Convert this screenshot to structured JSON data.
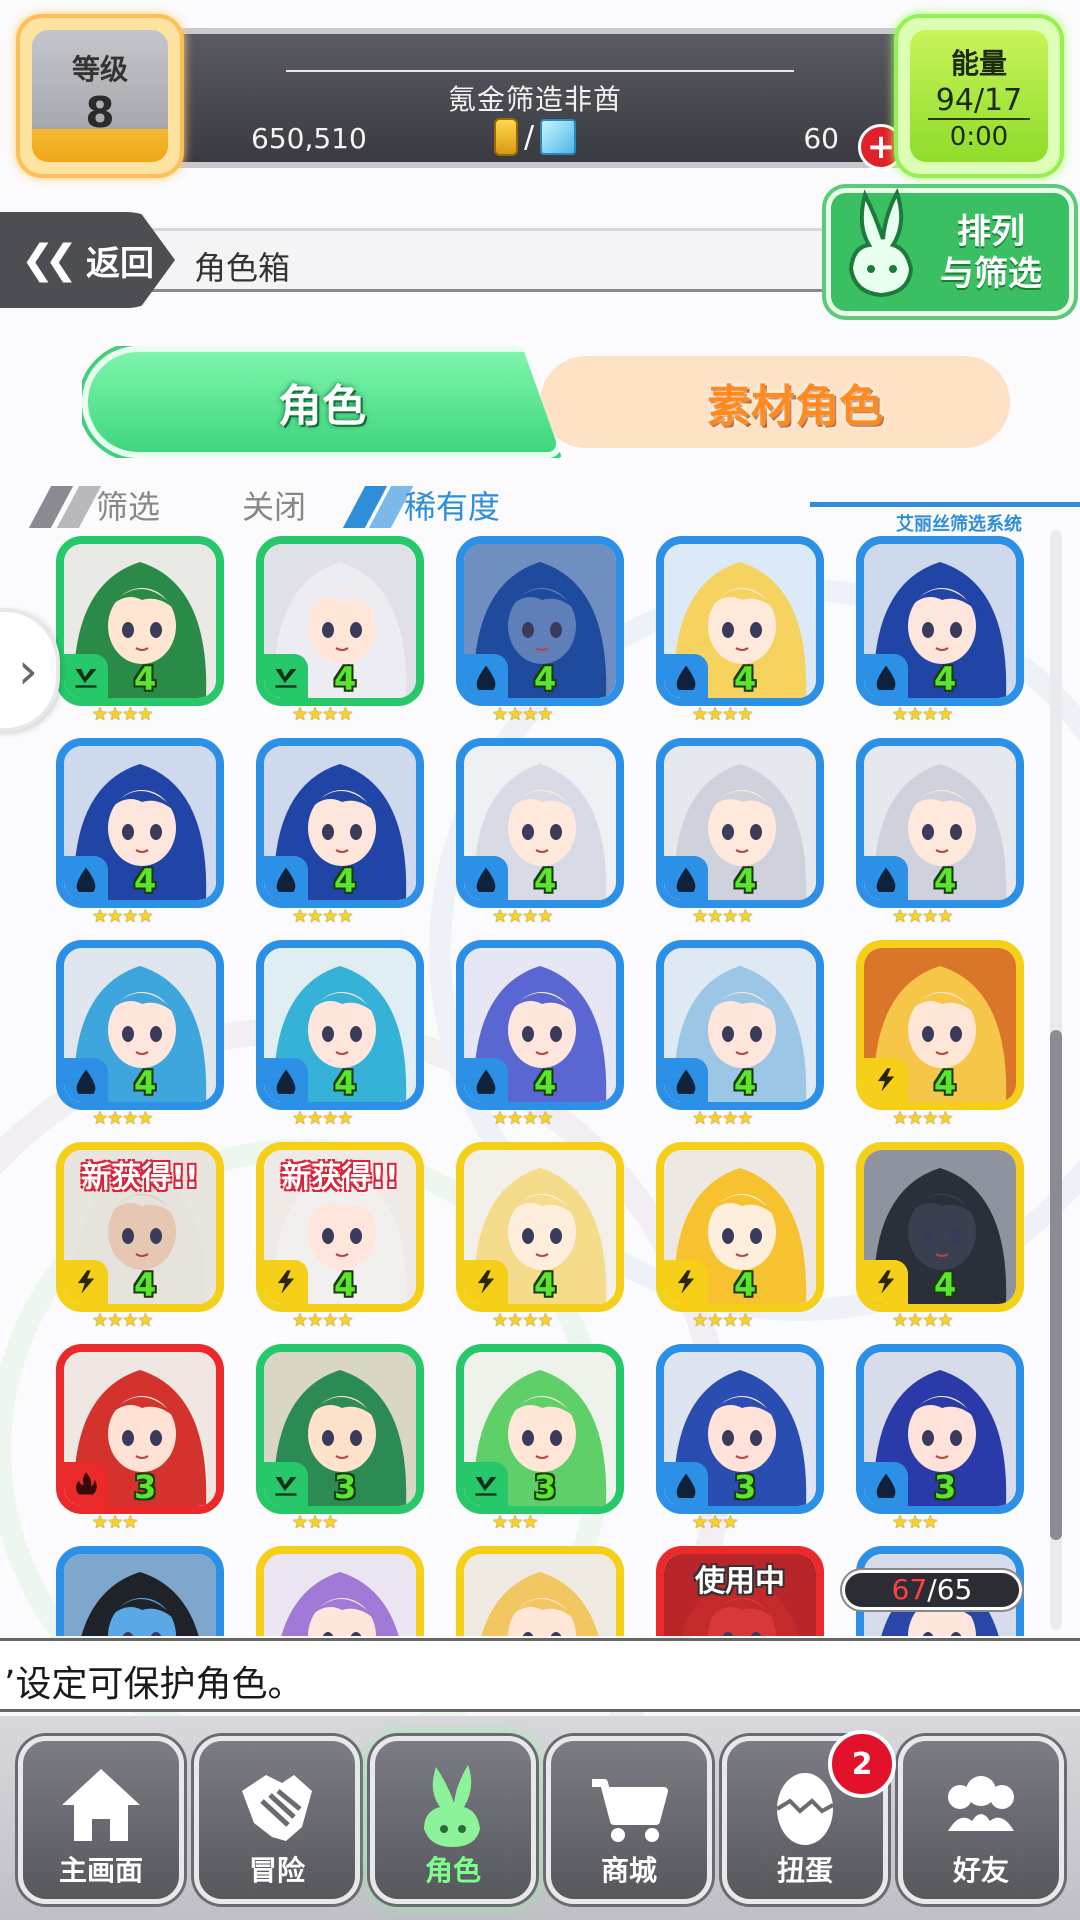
{
  "header": {
    "level_label": "等级",
    "level_value": "8",
    "player_name": "氪金筛造非酋",
    "gold": "650,510",
    "currency_separator": "/",
    "gems": "60",
    "energy_label": "能量",
    "energy_value": "94/17",
    "energy_timer": "0:00"
  },
  "nav": {
    "back_label": "返回",
    "page_title": "角色箱",
    "sort_filter_label_1": "排列",
    "sort_filter_label_2": "与筛选"
  },
  "tabs": {
    "character": "角色",
    "material": "素材角色"
  },
  "filter": {
    "filter_label": "筛选",
    "filter_value": "关闭",
    "sort_value": "稀有度",
    "system_label": "艾丽丝筛选系统"
  },
  "grid": {
    "new_tag": "新获得!!",
    "in_use_tag": "使用中",
    "cards": [
      {
        "color": "green",
        "element": "wind",
        "rank": "4",
        "stars": 4,
        "hair": "#2a8a48",
        "skin": "#ffe6d2",
        "bg": "#e9eae6"
      },
      {
        "color": "green",
        "element": "wind",
        "rank": "4",
        "stars": 4,
        "hair": "#ececf2",
        "skin": "#ffe6d8",
        "bg": "#dfe1e6"
      },
      {
        "color": "blue",
        "element": "water",
        "rank": "4",
        "stars": 4,
        "hair": "#1f4b9e",
        "skin": "#5f7fb8",
        "bg": "#6e8fbf"
      },
      {
        "color": "blue",
        "element": "water",
        "rank": "4",
        "stars": 4,
        "hair": "#f6d35e",
        "skin": "#ffe9d8",
        "bg": "#dce9f6"
      },
      {
        "color": "blue",
        "element": "water",
        "rank": "4",
        "stars": 4,
        "hair": "#2145a6",
        "skin": "#ffe6dc",
        "bg": "#cfd9ee"
      },
      {
        "color": "blue",
        "element": "water",
        "rank": "4",
        "stars": 4,
        "hair": "#2145a6",
        "skin": "#ffe6dc",
        "bg": "#cfd9ee"
      },
      {
        "color": "blue",
        "element": "water",
        "rank": "4",
        "stars": 4,
        "hair": "#2145a6",
        "skin": "#ffe6dc",
        "bg": "#cfd9ee"
      },
      {
        "color": "blue",
        "element": "water",
        "rank": "4",
        "stars": 4,
        "hair": "#d8dbe6",
        "skin": "#ffe8dc",
        "bg": "#eef0f4"
      },
      {
        "color": "blue",
        "element": "water",
        "rank": "4",
        "stars": 4,
        "hair": "#cfd2dc",
        "skin": "#ffe8dc",
        "bg": "#e6e8ee"
      },
      {
        "color": "blue",
        "element": "water",
        "rank": "4",
        "stars": 4,
        "hair": "#cfd2dc",
        "skin": "#ffe8dc",
        "bg": "#e6e8ee"
      },
      {
        "color": "blue",
        "element": "water",
        "rank": "4",
        "stars": 4,
        "hair": "#3fa6dd",
        "skin": "#ffe6dc",
        "bg": "#dfe6ee"
      },
      {
        "color": "blue",
        "element": "water",
        "rank": "4",
        "stars": 4,
        "hair": "#36b2d8",
        "skin": "#ffe6dc",
        "bg": "#e0eef4"
      },
      {
        "color": "blue",
        "element": "water",
        "rank": "4",
        "stars": 4,
        "hair": "#5a66d2",
        "skin": "#ffe6dc",
        "bg": "#e6e6f4"
      },
      {
        "color": "blue",
        "element": "water",
        "rank": "4",
        "stars": 4,
        "hair": "#9cc6e6",
        "skin": "#ffe6dc",
        "bg": "#dfe9f4"
      },
      {
        "color": "yellow",
        "element": "thunder",
        "rank": "4",
        "stars": 4,
        "hair": "#f6c648",
        "skin": "#ffe6d6",
        "bg": "#d9762a"
      },
      {
        "color": "yellow",
        "element": "thunder",
        "rank": "4",
        "stars": 4,
        "hair": "#e6e2dc",
        "skin": "#e6c8b2",
        "bg": "#e8e4de",
        "new": true
      },
      {
        "color": "yellow",
        "element": "thunder",
        "rank": "4",
        "stars": 4,
        "hair": "#f2f0ee",
        "skin": "#ffe6dc",
        "bg": "#efeae6",
        "new": true
      },
      {
        "color": "yellow",
        "element": "thunder",
        "rank": "4",
        "stars": 4,
        "hair": "#f4dc8a",
        "skin": "#ffeedc",
        "bg": "#f2f0e8"
      },
      {
        "color": "yellow",
        "element": "thunder",
        "rank": "4",
        "stars": 4,
        "hair": "#f6c230",
        "skin": "#ffeedc",
        "bg": "#eee8e2"
      },
      {
        "color": "yellow",
        "element": "thunder",
        "rank": "4",
        "stars": 4,
        "hair": "#2a2f3a",
        "skin": "#3a4050",
        "bg": "#8f93a0"
      },
      {
        "color": "red",
        "element": "fire",
        "rank": "3",
        "stars": 3,
        "hair": "#d4322c",
        "skin": "#ffe2d6",
        "bg": "#f0e6e2"
      },
      {
        "color": "green",
        "element": "wind",
        "rank": "3",
        "stars": 3,
        "hair": "#2c8a54",
        "skin": "#ffe2cc",
        "bg": "#d9d6c6"
      },
      {
        "color": "green",
        "element": "wind",
        "rank": "3",
        "stars": 3,
        "hair": "#5fcf6a",
        "skin": "#ffe6d6",
        "bg": "#eef2ea"
      },
      {
        "color": "blue",
        "element": "water",
        "rank": "3",
        "stars": 3,
        "hair": "#2a4db2",
        "skin": "#ffe2da",
        "bg": "#dfe4f2"
      },
      {
        "color": "blue",
        "element": "water",
        "rank": "3",
        "stars": 3,
        "hair": "#2a3aa8",
        "skin": "#ffe2da",
        "bg": "#d8dbea"
      },
      {
        "color": "blue",
        "element": "water",
        "rank": "",
        "stars": 0,
        "hair": "#20222a",
        "skin": "#5aa9e6",
        "bg": "#7fa6cc"
      },
      {
        "color": "yellow",
        "element": "thunder",
        "rank": "",
        "stars": 0,
        "hair": "#a07ad6",
        "skin": "#ffe6dc",
        "bg": "#ece6f2"
      },
      {
        "color": "yellow",
        "element": "thunder",
        "rank": "",
        "stars": 0,
        "hair": "#f2c660",
        "skin": "#ffe6d6",
        "bg": "#f0ebe2"
      },
      {
        "color": "red",
        "element": "fire",
        "rank": "",
        "stars": 0,
        "hair": "#c42a2a",
        "skin": "#d8383a",
        "bg": "#b8262a",
        "in_use": true
      },
      {
        "color": "blue",
        "element": "water",
        "rank": "",
        "stars": 0,
        "hair": "#2a46a8",
        "skin": "#ffe6dc",
        "bg": "#d6dcec"
      }
    ]
  },
  "count": {
    "current": "67",
    "separator": "/",
    "max": "65"
  },
  "hint_text": "’设定可保护角色。",
  "bottom_nav": {
    "home": "主画面",
    "adventure": "冒险",
    "character": "角色",
    "shop": "商城",
    "gacha": "扭蛋",
    "friends": "好友",
    "gacha_badge": "2"
  },
  "colors": {
    "green": "#27c86a",
    "blue": "#2b90e6",
    "yellow": "#f6cf18",
    "red": "#ea2a2a",
    "rank_text": "#5be62e",
    "accent_blue": "#2e8fd8"
  }
}
